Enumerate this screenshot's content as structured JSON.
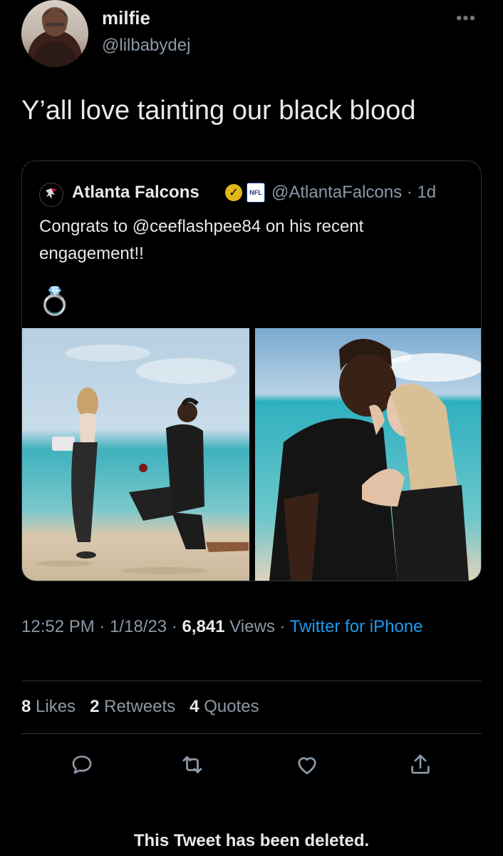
{
  "author": {
    "name": "milfie",
    "handle": "@lilbabydej",
    "avatar_icon": "profile-photo"
  },
  "tweet": {
    "text": "Y’all love tainting our black blood"
  },
  "quoted": {
    "name": "Atlanta Falcons",
    "handle_time": "@AtlantaFalcons · 1d",
    "text": "Congrats to @ceeflashpee84 on his recent engagement!!",
    "emoji": "💍",
    "verified_color": "#e2b719"
  },
  "meta": {
    "time": "12:52 PM",
    "date": "1/18/23",
    "views_count": "6,841",
    "views_label": "Views",
    "source": "Twitter for iPhone"
  },
  "stats": {
    "likes_count": "8",
    "likes_label": "Likes",
    "retweets_count": "2",
    "retweets_label": "Retweets",
    "quotes_count": "4",
    "quotes_label": "Quotes"
  },
  "footer": {
    "deleted_notice": "This Tweet has been deleted."
  },
  "colors": {
    "background": "#000000",
    "text": "#e7e9ea",
    "muted": "#8b98a5",
    "link": "#1d9bf0"
  }
}
